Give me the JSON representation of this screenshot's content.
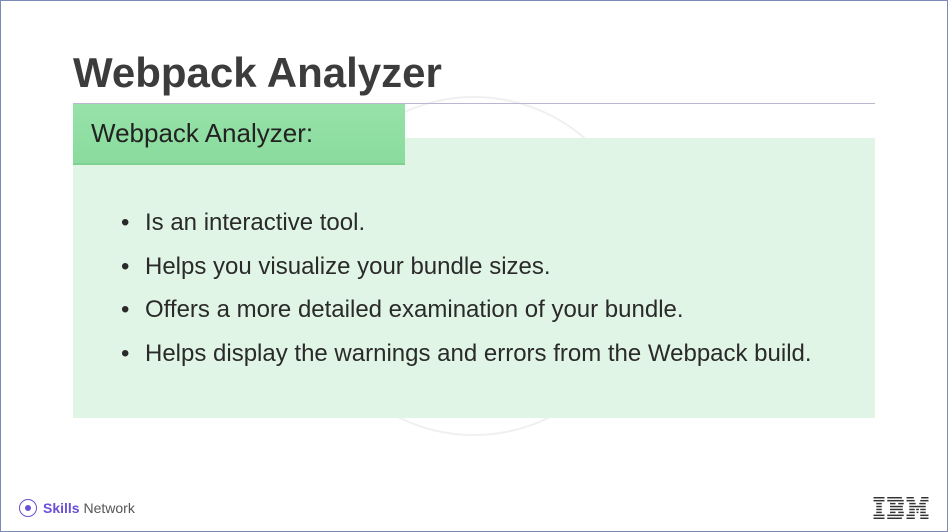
{
  "title": "Webpack Analyzer",
  "card": {
    "header": "Webpack Analyzer:",
    "bullets": [
      "Is an interactive tool.",
      "Helps you visualize your bundle sizes.",
      "Offers a more detailed examination of your bundle.",
      "Helps display the warnings and errors from the Webpack build."
    ]
  },
  "footer": {
    "skills": "Skills",
    "network": " Network",
    "company": "IBM"
  }
}
